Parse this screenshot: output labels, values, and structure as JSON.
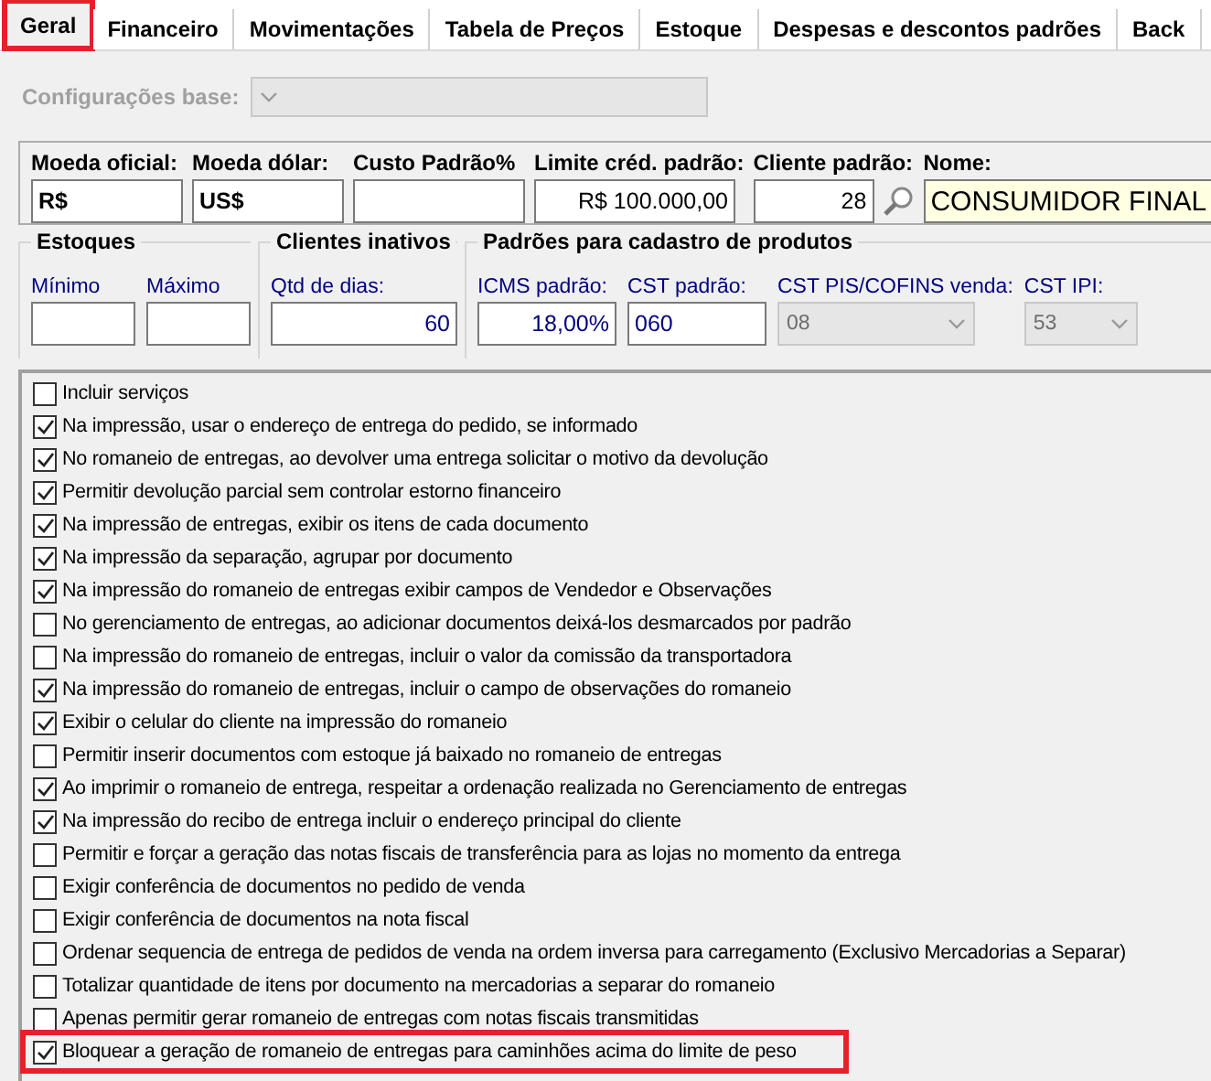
{
  "tabs": [
    {
      "label": "Geral",
      "selected": true,
      "highlighted": true
    },
    {
      "label": "Financeiro",
      "selected": false,
      "highlighted": false
    },
    {
      "label": "Movimentações",
      "selected": false,
      "highlighted": false
    },
    {
      "label": "Tabela de Preços",
      "selected": false,
      "highlighted": false
    },
    {
      "label": "Estoque",
      "selected": false,
      "highlighted": false
    },
    {
      "label": "Despesas e descontos padrões",
      "selected": false,
      "highlighted": false
    },
    {
      "label": "Back",
      "selected": false,
      "highlighted": false
    }
  ],
  "base_config": {
    "label": "Configurações base:",
    "disabled": true
  },
  "currency_panel": {
    "fields": [
      {
        "label": "Moeda oficial:",
        "value": "R$",
        "kind": "currency"
      },
      {
        "label": "Moeda dólar:",
        "value": "US$",
        "kind": "currency"
      },
      {
        "label": "Custo Padrão%",
        "kind": "text"
      },
      {
        "label": "Limite créd. padrão:",
        "value": "R$ 100.000,00",
        "kind": "number"
      },
      {
        "label": "Cliente padrão:",
        "value": "28",
        "kind": "lookup"
      },
      {
        "label": "Nome:",
        "value": "CONSUMIDOR FINAL",
        "kind": "name"
      }
    ]
  },
  "groups": [
    {
      "title": "Estoques",
      "fields": [
        {
          "label": "Mínimo",
          "kind": "text"
        },
        {
          "label": "Máximo",
          "kind": "text"
        }
      ]
    },
    {
      "title": "Clientes inativos",
      "fields": [
        {
          "label": "Qtd de dias:",
          "value": "60",
          "kind": "number"
        }
      ]
    },
    {
      "title": "Padrões para cadastro de produtos",
      "fields": [
        {
          "label": "ICMS padrão:",
          "value": "18,00%",
          "kind": "number"
        },
        {
          "label": "CST padrão:",
          "value": "060",
          "kind": "text"
        },
        {
          "label": "CST PIS/COFINS venda:",
          "value": "08",
          "kind": "combo",
          "disabled": true
        },
        {
          "label": "CST IPI:",
          "value": "53",
          "kind": "combo",
          "disabled": true
        }
      ]
    }
  ],
  "options": [
    {
      "label": "Incluir serviços",
      "checked": false,
      "highlighted": false
    },
    {
      "label": "Na impressão, usar o endereço de entrega do pedido, se informado",
      "checked": true,
      "highlighted": false
    },
    {
      "label": "No romaneio de entregas, ao devolver uma entrega solicitar o motivo da devolução",
      "checked": true,
      "highlighted": false
    },
    {
      "label": "Permitir devolução parcial sem controlar estorno financeiro",
      "checked": true,
      "highlighted": false
    },
    {
      "label": "Na impressão de entregas, exibir os itens de cada documento",
      "checked": true,
      "highlighted": false
    },
    {
      "label": "Na impressão da separação, agrupar por documento",
      "checked": true,
      "highlighted": false
    },
    {
      "label": "Na impressão do romaneio de entregas exibir campos de Vendedor e Observações",
      "checked": true,
      "highlighted": false
    },
    {
      "label": "No gerenciamento de entregas, ao adicionar documentos deixá-los desmarcados por padrão",
      "checked": false,
      "highlighted": false
    },
    {
      "label": "Na impressão do romaneio de entregas, incluir o valor da comissão da transportadora",
      "checked": false,
      "highlighted": false
    },
    {
      "label": "Na impressão do romaneio de entregas, incluir o campo de observações do romaneio",
      "checked": true,
      "highlighted": false
    },
    {
      "label": "Exibir o celular do cliente na impressão do romaneio",
      "checked": true,
      "highlighted": false
    },
    {
      "label": "Permitir inserir documentos com estoque já baixado no romaneio de entregas",
      "checked": false,
      "highlighted": false
    },
    {
      "label": "Ao imprimir o romaneio de entrega, respeitar a ordenação realizada no Gerenciamento de entregas",
      "checked": true,
      "highlighted": false
    },
    {
      "label": "Na impressão do recibo de entrega incluir o endereço principal do cliente",
      "checked": true,
      "highlighted": false
    },
    {
      "label": "Permitir e forçar a geração das notas fiscais de transferência para as lojas no momento da entrega",
      "checked": false,
      "highlighted": false
    },
    {
      "label": "Exigir conferência de documentos no pedido de venda",
      "checked": false,
      "highlighted": false
    },
    {
      "label": "Exigir conferência de documentos na nota fiscal",
      "checked": false,
      "highlighted": false
    },
    {
      "label": "Ordenar sequencia de entrega de pedidos de venda na ordem inversa para carregamento (Exclusivo Mercadorias a Separar)",
      "checked": false,
      "highlighted": false
    },
    {
      "label": "Totalizar quantidade de itens por documento na mercadorias a separar do romaneio",
      "checked": false,
      "highlighted": false
    },
    {
      "label": "Apenas permitir gerar romaneio de entregas com notas fiscais transmitidas",
      "checked": false,
      "highlighted": false
    },
    {
      "label": "Bloquear a geração de romaneio de entregas para caminhões acima do limite de peso",
      "checked": true,
      "highlighted": true
    }
  ]
}
